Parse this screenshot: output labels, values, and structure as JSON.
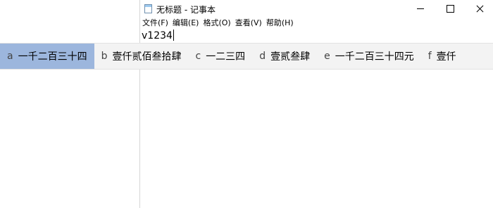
{
  "window": {
    "title": "无标题 - 记事本",
    "minimize_icon": "minimize-icon",
    "maximize_icon": "maximize-icon",
    "close_icon": "close-icon"
  },
  "menu": {
    "items": [
      "文件(F)",
      "编辑(E)",
      "格式(O)",
      "查看(V)",
      "帮助(H)"
    ]
  },
  "editor": {
    "content": "v1234"
  },
  "ime": {
    "candidates": [
      {
        "key": "a",
        "text": "一千二百三十四",
        "selected": true
      },
      {
        "key": "b",
        "text": "壹仟贰佰叁拾肆",
        "selected": false
      },
      {
        "key": "c",
        "text": "一二三四",
        "selected": false
      },
      {
        "key": "d",
        "text": "壹贰叁肆",
        "selected": false
      },
      {
        "key": "e",
        "text": "一千二百三十四元",
        "selected": false
      },
      {
        "key": "f",
        "text": "壹仟",
        "selected": false
      }
    ],
    "selected_color": "#9cb6dd",
    "bar_color": "#f3f3f3"
  }
}
